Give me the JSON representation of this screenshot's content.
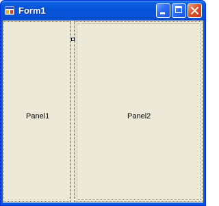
{
  "window": {
    "title": "Form1",
    "icon": "form-app-icon",
    "buttons": {
      "minimize": "minimize-icon",
      "maximize": "maximize-icon",
      "close": "close-icon"
    }
  },
  "panels": {
    "panel1_label": "Panel1",
    "panel2_label": "Panel2"
  },
  "colors": {
    "title_bar": "#0553d6",
    "client_background": "#ece9d8",
    "close_button": "#e0542c"
  }
}
